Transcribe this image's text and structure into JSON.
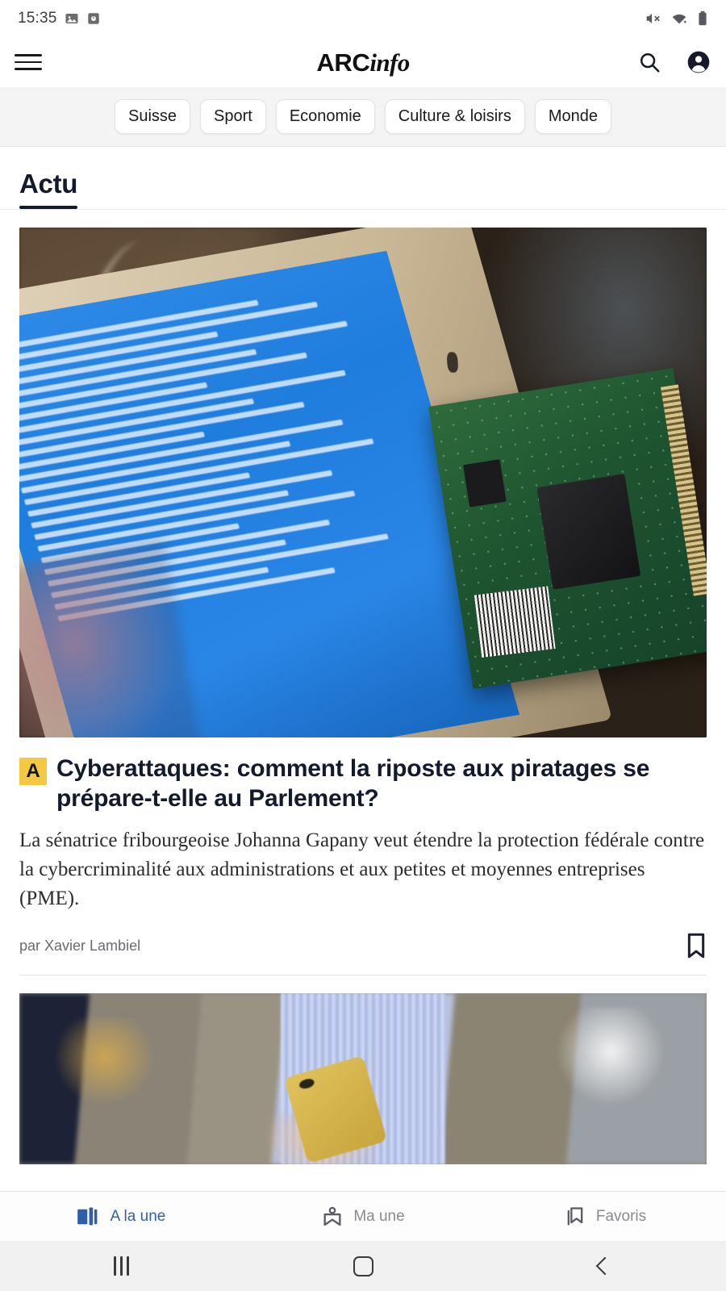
{
  "status_bar": {
    "time": "15:35",
    "left_icons": [
      "image-icon",
      "screenshot-icon"
    ],
    "right_icons": [
      "mute-icon",
      "wifi-icon",
      "battery-icon"
    ]
  },
  "header": {
    "menu_icon": "hamburger-menu-icon",
    "brand_primary": "ARC",
    "brand_secondary": "info",
    "search_icon": "search-icon",
    "account_icon": "account-circle-icon"
  },
  "categories": [
    {
      "label": "Suisse"
    },
    {
      "label": "Sport"
    },
    {
      "label": "Economie"
    },
    {
      "label": "Culture & loisirs"
    },
    {
      "label": "Monde"
    }
  ],
  "section_tabs": [
    {
      "label": "Actu",
      "active": true
    }
  ],
  "articles": [
    {
      "badge": "A",
      "title": "Cyberattaques: comment la riposte aux piratages se prépare-t-elle au Parlement?",
      "lead": "La sénatrice fribourgeoise Johanna Gapany veut étendre la protection fédérale  contre la cybercriminalité aux administrations et aux petites et moyennes entreprises (PME).",
      "author": "par Xavier Lambiel",
      "bookmark_icon": "bookmark-outline-icon",
      "image_alt": "laptop-circuit-board-photo"
    },
    {
      "image_alt": "person-holding-gold-phone-photo"
    }
  ],
  "bottom_nav": [
    {
      "label": "A la une",
      "icon": "open-book-icon",
      "active": true
    },
    {
      "label": "Ma une",
      "icon": "personal-feed-icon",
      "active": false
    },
    {
      "label": "Favoris",
      "icon": "bookmarks-stack-icon",
      "active": false
    }
  ],
  "android_nav": [
    {
      "icon": "recents-icon"
    },
    {
      "icon": "home-icon"
    },
    {
      "icon": "back-icon"
    }
  ],
  "colors": {
    "accent_badge": "#f4c842",
    "active_nav": "#2f5fa8",
    "text_primary": "#131a2b",
    "chip_bg": "#f4f4f5"
  }
}
